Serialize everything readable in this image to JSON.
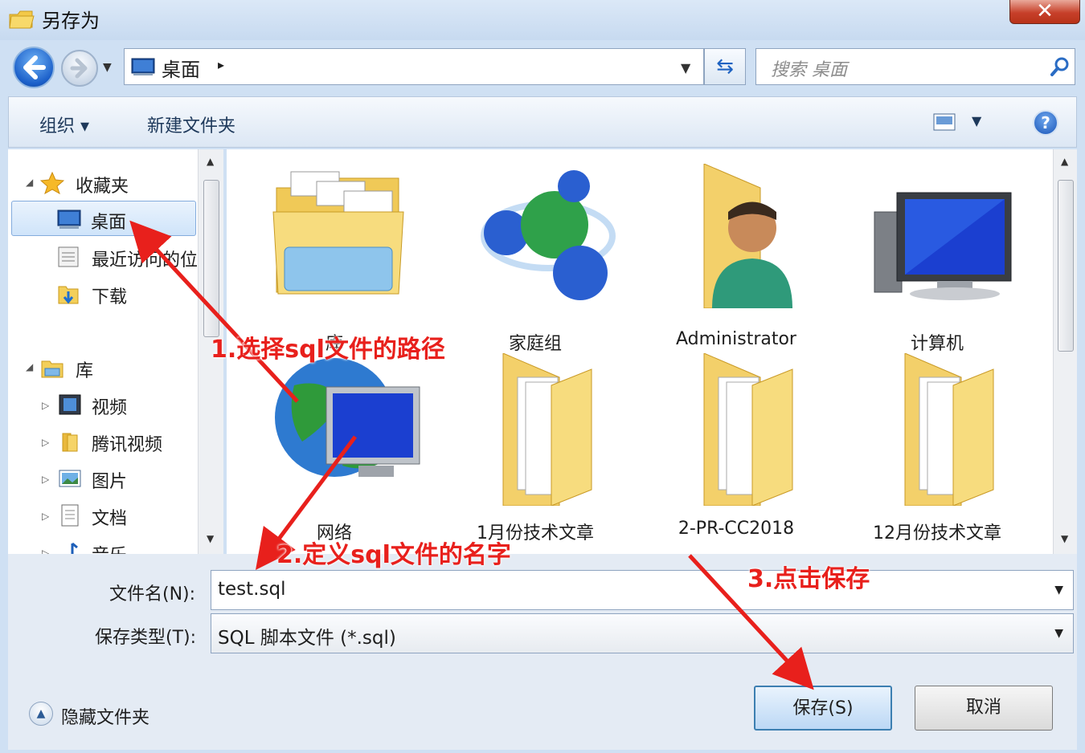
{
  "window": {
    "title": "另存为",
    "close_label": "✕"
  },
  "address": {
    "location": "桌面",
    "separator": "▸",
    "search_placeholder": "搜索 桌面"
  },
  "toolbar": {
    "organize": "组织 ▾",
    "new_folder": "新建文件夹",
    "help": "?"
  },
  "nav": {
    "favorites": "收藏夹",
    "desktop": "桌面",
    "recent": "最近访问的位置",
    "downloads": "下载",
    "libraries": "库",
    "videos": "视频",
    "tencent_video": "腾讯视频",
    "pictures": "图片",
    "documents": "文档",
    "music": "音乐"
  },
  "items": [
    {
      "label": "库",
      "icon": "library-folder-icon"
    },
    {
      "label": "家庭组",
      "icon": "homegroup-icon"
    },
    {
      "label": "Administrator",
      "icon": "user-folder-icon"
    },
    {
      "label": "计算机",
      "icon": "computer-icon"
    },
    {
      "label": "网络",
      "icon": "network-icon"
    },
    {
      "label": "1月份技术文章",
      "icon": "folder-icon"
    },
    {
      "label": "2-PR-CC2018",
      "icon": "folder-icon"
    },
    {
      "label": "12月份技术文章",
      "icon": "folder-icon"
    }
  ],
  "form": {
    "filename_label": "文件名(N):",
    "filename_value": "test.sql",
    "filetype_label": "保存类型(T):",
    "filetype_value": "SQL 脚本文件 (*.sql)",
    "save": "保存(S)",
    "cancel": "取消",
    "hide_folders": "隐藏文件夹"
  },
  "annotations": {
    "step1": "1.选择sql文件的路径",
    "step2": "2.定义sql文件的名字",
    "step3": "3.点击保存"
  },
  "colors": {
    "annotation": "#e8201c",
    "accent": "#1b5fc9"
  }
}
